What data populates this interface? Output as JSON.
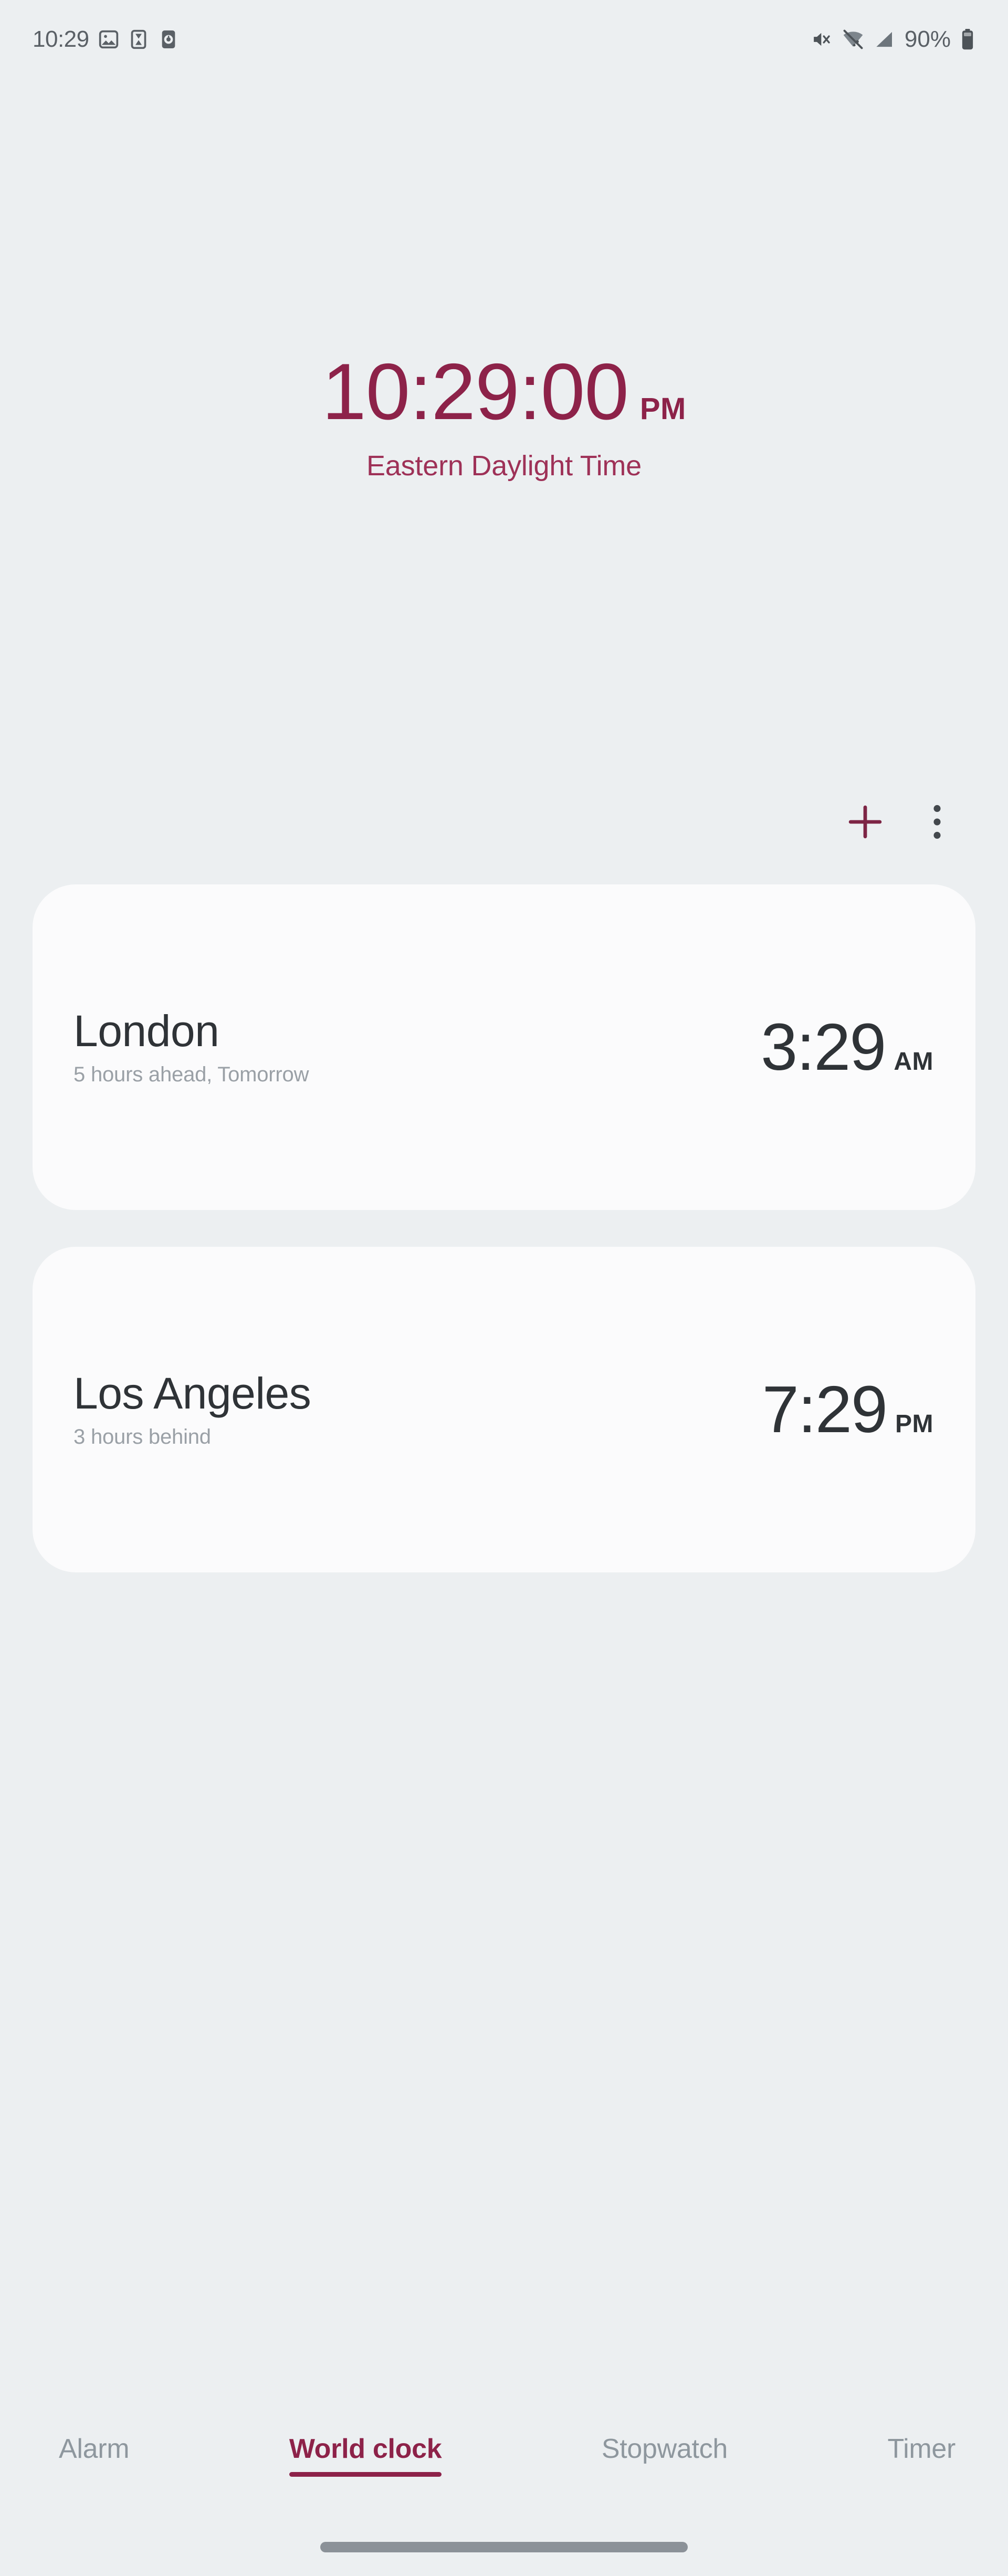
{
  "status_bar": {
    "time": "10:29",
    "battery_percent": "90%",
    "left_icons": [
      "photo-icon",
      "hourglass-icon",
      "alarm-clock-icon"
    ],
    "right_icons": [
      "volume-mute-icon",
      "wifi-off-icon",
      "cellular-signal-icon",
      "battery-icon"
    ],
    "text_color": "#5a6066"
  },
  "hero_clock": {
    "time": "10:29:00",
    "meridiem": "PM",
    "timezone": "Eastern Daylight Time",
    "color": "#8d2249"
  },
  "toolbar": {
    "add_icon": "plus-icon",
    "add_label": "Add city",
    "menu_icon": "overflow-menu-icon",
    "menu_label": "More options",
    "icon_color": "#7d2545"
  },
  "cities": [
    {
      "name": "London",
      "offset": "5 hours ahead, Tomorrow",
      "time": "3:29",
      "meridiem": "AM"
    },
    {
      "name": "Los Angeles",
      "offset": "3 hours behind",
      "time": "7:29",
      "meridiem": "PM"
    }
  ],
  "tabs": [
    {
      "label": "Alarm",
      "active": false
    },
    {
      "label": "World clock",
      "active": true
    },
    {
      "label": "Stopwatch",
      "active": false
    },
    {
      "label": "Timer",
      "active": false
    }
  ],
  "theme": {
    "page_background": "#eceff1",
    "card_background": "#fbfbfc",
    "accent": "#8d2249",
    "primary_text": "#2f3337",
    "secondary_text": "#9aa0a6",
    "inactive_tab": "#8e979e"
  },
  "gesture_bar": {
    "name": "home-gesture-bar"
  }
}
